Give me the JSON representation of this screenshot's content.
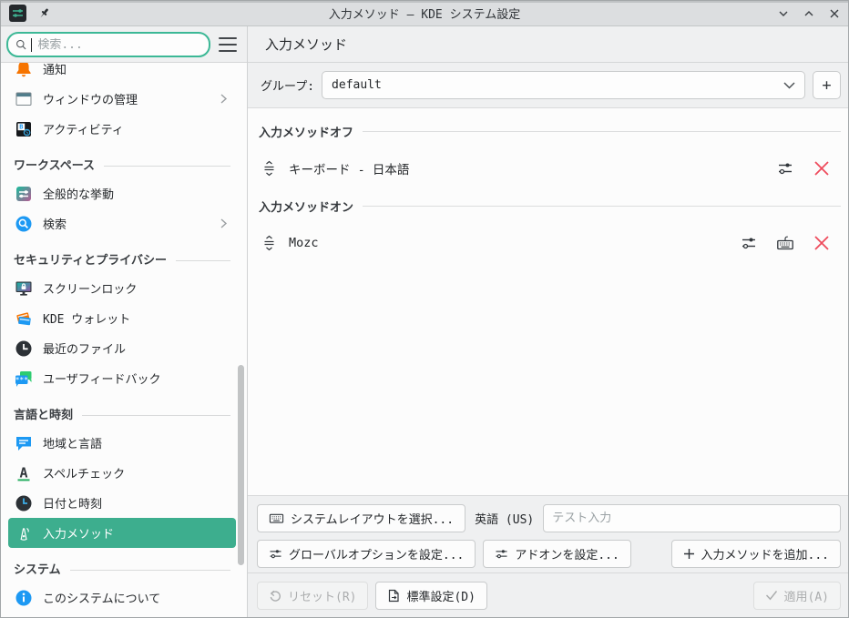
{
  "titlebar": {
    "title": "入力メソッド – KDE システム設定"
  },
  "toolbar": {
    "search_placeholder": "検索...",
    "page_title": "入力メソッド"
  },
  "sidebar": {
    "items": [
      {
        "type": "item",
        "icon": "notifications-icon",
        "label": "通知"
      },
      {
        "type": "item",
        "icon": "window-management-icon",
        "label": "ウィンドウの管理",
        "chevron": true
      },
      {
        "type": "item",
        "icon": "activities-icon",
        "label": "アクティビティ"
      },
      {
        "type": "section",
        "label": "ワークスペース"
      },
      {
        "type": "item",
        "icon": "general-behavior-icon",
        "label": "全般的な挙動"
      },
      {
        "type": "item",
        "icon": "search-globe-icon",
        "label": "検索",
        "chevron": true
      },
      {
        "type": "section",
        "label": "セキュリティとプライバシー"
      },
      {
        "type": "item",
        "icon": "screen-lock-icon",
        "label": "スクリーンロック"
      },
      {
        "type": "item",
        "icon": "wallet-icon",
        "label": "KDE ウォレット"
      },
      {
        "type": "item",
        "icon": "recent-files-icon",
        "label": "最近のファイル"
      },
      {
        "type": "item",
        "icon": "user-feedback-icon",
        "label": "ユーザフィードバック"
      },
      {
        "type": "section",
        "label": "言語と時刻"
      },
      {
        "type": "item",
        "icon": "region-language-icon",
        "label": "地域と言語"
      },
      {
        "type": "item",
        "icon": "spellcheck-icon",
        "label": "スペルチェック"
      },
      {
        "type": "item",
        "icon": "date-time-icon",
        "label": "日付と時刻"
      },
      {
        "type": "item",
        "icon": "input-method-icon",
        "label": "入力メソッド",
        "selected": true
      },
      {
        "type": "section",
        "label": "システム"
      },
      {
        "type": "item",
        "icon": "about-system-icon",
        "label": "このシステムについて"
      }
    ]
  },
  "content": {
    "group": {
      "label": "グループ:",
      "value": "default"
    },
    "off_section": {
      "title": "入力メソッドオフ",
      "item": {
        "label": "キーボード - 日本語"
      }
    },
    "on_section": {
      "title": "入力メソッドオン",
      "item": {
        "label": "Mozc"
      }
    },
    "panel": {
      "select_layout": "システムレイアウトを選択...",
      "current_layout": "英語 (US)",
      "test_placeholder": "テスト入力",
      "configure_global": "グローバルオプションを設定...",
      "configure_addons": "アドオンを設定...",
      "add_method": "入力メソッドを追加..."
    },
    "footer": {
      "reset": "リセット(R)",
      "defaults": "標準設定(D)",
      "apply": "適用(A)"
    }
  },
  "colors": {
    "accent": "#3dae8e",
    "danger": "#ee4b5c",
    "search_focus": "#3cb896"
  }
}
